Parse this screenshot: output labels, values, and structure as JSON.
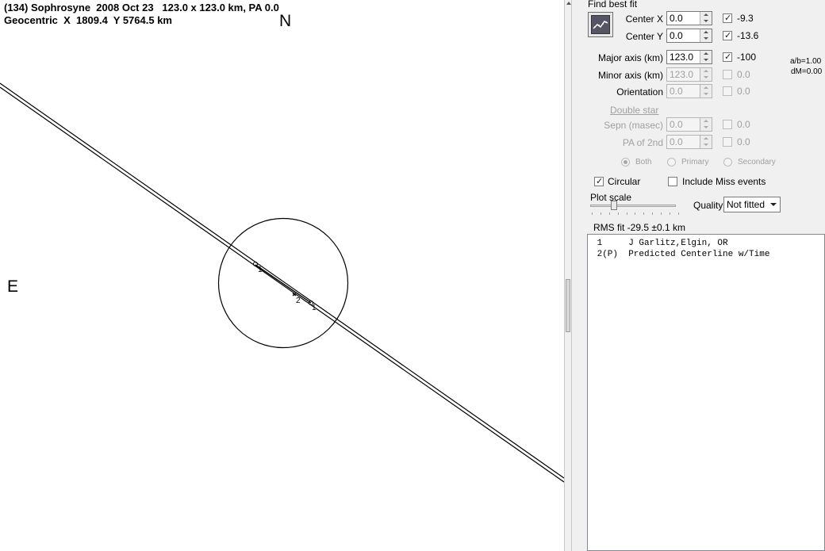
{
  "plot": {
    "title_line1": "(134) Sophrosyne  2008 Oct 23   123.0 x 123.0 km, PA 0.0",
    "title_line2": "Geocentric  X  1809.4  Y 5764.5 km",
    "north_label": "N",
    "east_label": "E",
    "chord_labels": {
      "c1": "1",
      "c2": "2",
      "c3": "1"
    }
  },
  "panel": {
    "group_title": "Find best fit",
    "fit_button_icon": "chart-fit-icon",
    "center_x": {
      "label": "Center X",
      "value": "0.0",
      "checked": true,
      "result": "-9.3"
    },
    "center_y": {
      "label": "Center Y",
      "value": "0.0",
      "checked": true,
      "result": "-13.6"
    },
    "major_axis": {
      "label": "Major axis (km)",
      "value": "123.0",
      "checked": true,
      "result": "-100"
    },
    "minor_axis": {
      "label": "Minor axis (km)",
      "value": "123.0",
      "checked": false,
      "result": "0.0"
    },
    "orientation": {
      "label": "Orientation",
      "value": "0.0",
      "checked": false,
      "result": "0.0"
    },
    "ratio_text": "a/b=1.00",
    "dm_text": "dM=0.00",
    "double_star": "Double star",
    "sepn": {
      "label": "Sepn (masec)",
      "value": "0.0",
      "checked": false,
      "result": "0.0"
    },
    "pa2": {
      "label": "PA of 2nd",
      "value": "0.0",
      "checked": false,
      "result": "0.0"
    },
    "radio_both": "Both",
    "radio_primary": "Primary",
    "radio_secondary": "Secondary",
    "circular_label": "Circular",
    "circular_checked": true,
    "include_miss_label": "Include Miss events",
    "include_miss_checked": false,
    "plot_scale_label": "Plot scale",
    "plot_scale_value": 0.3,
    "quality_label": "Quality",
    "quality_value": "Not fitted",
    "rms_text": "RMS fit -29.5 ±0.1 km",
    "observers": [
      {
        "text": " 1     J Garlitz,Elgin, OR"
      },
      {
        "text": " 2(P)  Predicted Centerline w/Time"
      }
    ]
  }
}
